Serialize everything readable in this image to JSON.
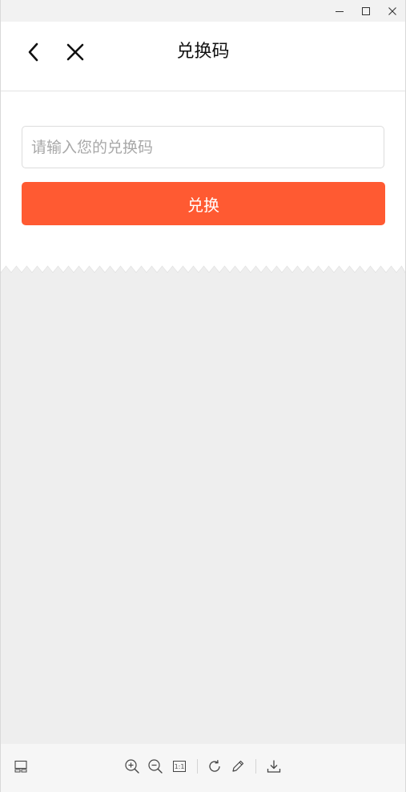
{
  "window": {
    "minimize_icon": "minimize-icon",
    "maximize_icon": "maximize-icon",
    "close_icon": "close-icon"
  },
  "nav": {
    "title": "兑换码",
    "back_icon": "back-arrow-icon",
    "close_icon": "close-x-icon"
  },
  "form": {
    "input_value": "",
    "input_placeholder": "请输入您的兑换码",
    "submit_label": "兑换"
  },
  "toolbar": {
    "fit_label": "1:1",
    "icons": [
      "layout-icon",
      "zoom-in-icon",
      "zoom-out-icon",
      "actual-size-icon",
      "rotate-icon",
      "edit-icon",
      "download-icon"
    ]
  },
  "colors": {
    "accent": "#ff5a32",
    "background_grey": "#eeeeee",
    "titlebar": "#f2f2f2"
  }
}
